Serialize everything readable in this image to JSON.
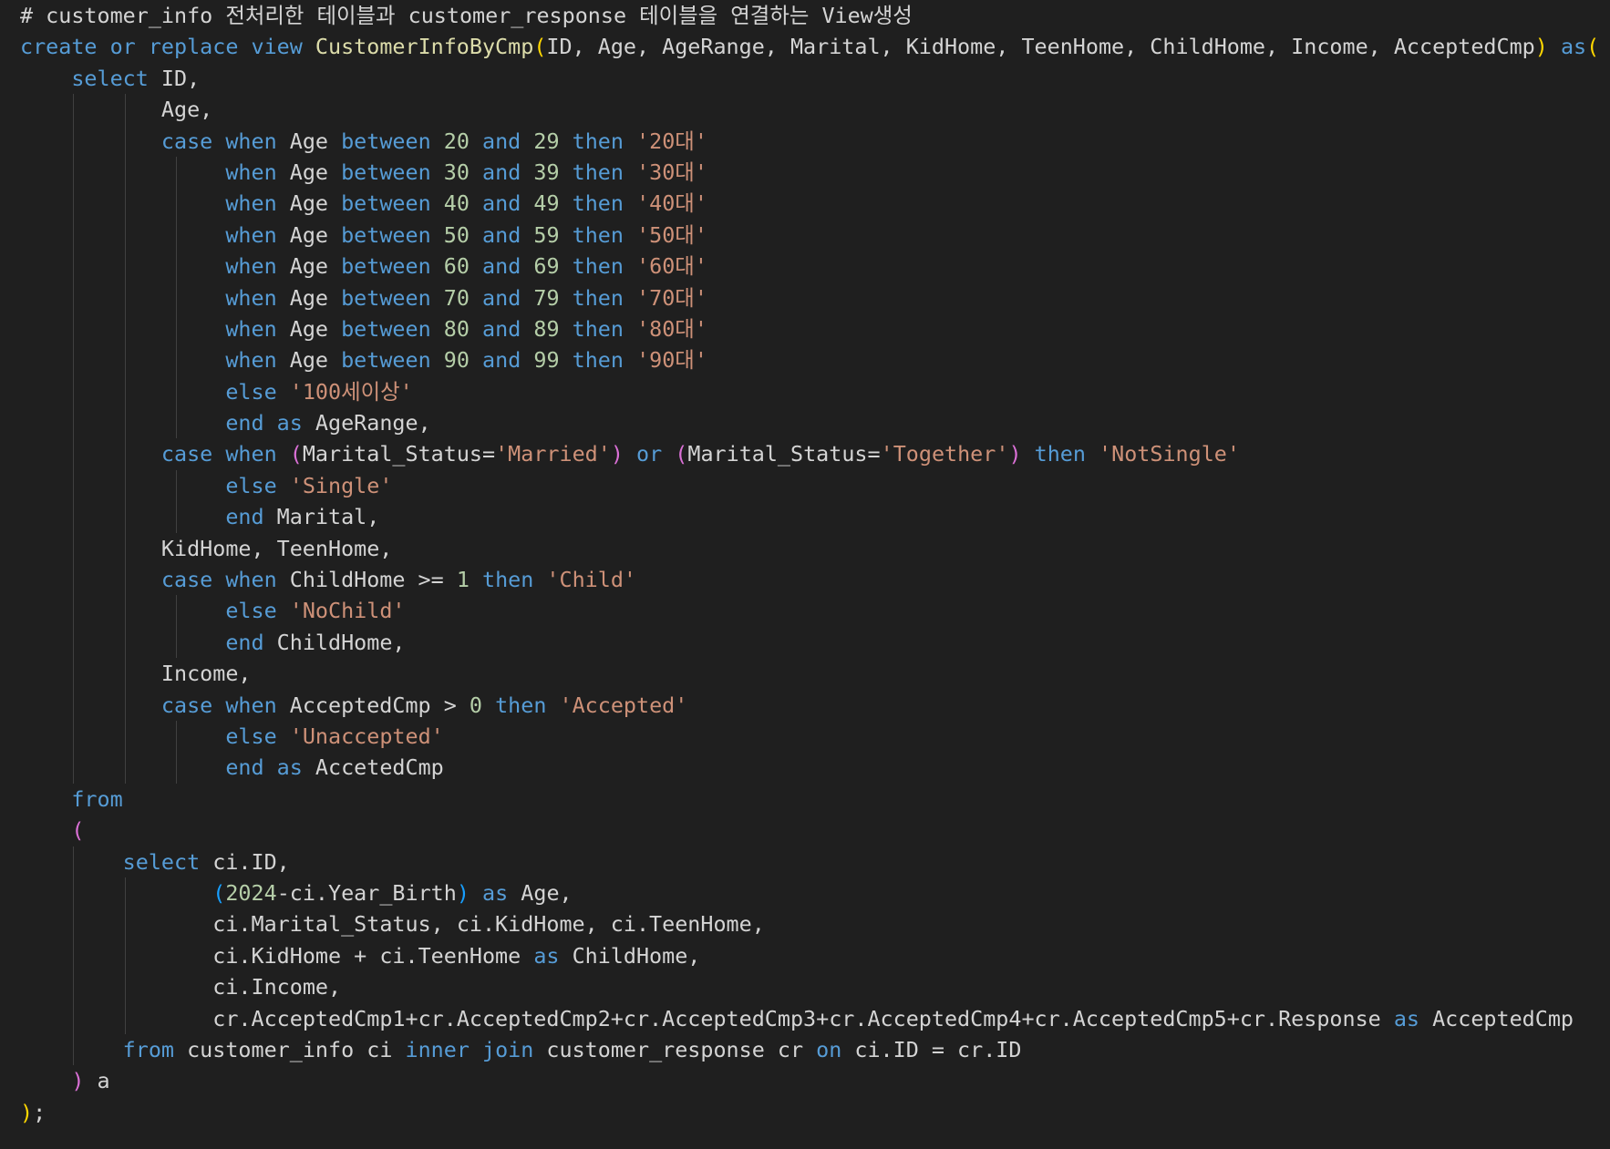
{
  "editor": {
    "lines": [
      {
        "indent": 0,
        "tokens": [
          {
            "t": "cmt",
            "v": "# customer_info 전처리한 테이블과 customer_response 테이블을 연결하는 View생성"
          }
        ]
      },
      {
        "indent": 0,
        "tokens": [
          {
            "t": "kw",
            "v": "create or replace view "
          },
          {
            "t": "fn",
            "v": "CustomerInfoByCmp"
          },
          {
            "t": "br1",
            "v": "("
          },
          {
            "t": "txt",
            "v": "ID, Age, AgeRange, Marital, KidHome, TeenHome, ChildHome, Income, AcceptedCmp"
          },
          {
            "t": "br1",
            "v": ")"
          },
          {
            "t": "txt",
            "v": " "
          },
          {
            "t": "kw",
            "v": "as"
          },
          {
            "t": "br1",
            "v": "("
          }
        ]
      },
      {
        "indent": 4,
        "tokens": [
          {
            "t": "kw",
            "v": "select "
          },
          {
            "t": "txt",
            "v": "ID,"
          }
        ]
      },
      {
        "indent": 11,
        "tokens": [
          {
            "t": "txt",
            "v": "Age,"
          }
        ]
      },
      {
        "indent": 11,
        "tokens": [
          {
            "t": "kw",
            "v": "case when "
          },
          {
            "t": "txt",
            "v": "Age "
          },
          {
            "t": "kw",
            "v": "between "
          },
          {
            "t": "num",
            "v": "20"
          },
          {
            "t": "txt",
            "v": " "
          },
          {
            "t": "kw",
            "v": "and "
          },
          {
            "t": "num",
            "v": "29"
          },
          {
            "t": "txt",
            "v": " "
          },
          {
            "t": "kw",
            "v": "then "
          },
          {
            "t": "str",
            "v": "'20대'"
          }
        ]
      },
      {
        "indent": 16,
        "tokens": [
          {
            "t": "kw",
            "v": "when "
          },
          {
            "t": "txt",
            "v": "Age "
          },
          {
            "t": "kw",
            "v": "between "
          },
          {
            "t": "num",
            "v": "30"
          },
          {
            "t": "txt",
            "v": " "
          },
          {
            "t": "kw",
            "v": "and "
          },
          {
            "t": "num",
            "v": "39"
          },
          {
            "t": "txt",
            "v": " "
          },
          {
            "t": "kw",
            "v": "then "
          },
          {
            "t": "str",
            "v": "'30대'"
          }
        ]
      },
      {
        "indent": 16,
        "tokens": [
          {
            "t": "kw",
            "v": "when "
          },
          {
            "t": "txt",
            "v": "Age "
          },
          {
            "t": "kw",
            "v": "between "
          },
          {
            "t": "num",
            "v": "40"
          },
          {
            "t": "txt",
            "v": " "
          },
          {
            "t": "kw",
            "v": "and "
          },
          {
            "t": "num",
            "v": "49"
          },
          {
            "t": "txt",
            "v": " "
          },
          {
            "t": "kw",
            "v": "then "
          },
          {
            "t": "str",
            "v": "'40대'"
          }
        ]
      },
      {
        "indent": 16,
        "tokens": [
          {
            "t": "kw",
            "v": "when "
          },
          {
            "t": "txt",
            "v": "Age "
          },
          {
            "t": "kw",
            "v": "between "
          },
          {
            "t": "num",
            "v": "50"
          },
          {
            "t": "txt",
            "v": " "
          },
          {
            "t": "kw",
            "v": "and "
          },
          {
            "t": "num",
            "v": "59"
          },
          {
            "t": "txt",
            "v": " "
          },
          {
            "t": "kw",
            "v": "then "
          },
          {
            "t": "str",
            "v": "'50대'"
          }
        ]
      },
      {
        "indent": 16,
        "tokens": [
          {
            "t": "kw",
            "v": "when "
          },
          {
            "t": "txt",
            "v": "Age "
          },
          {
            "t": "kw",
            "v": "between "
          },
          {
            "t": "num",
            "v": "60"
          },
          {
            "t": "txt",
            "v": " "
          },
          {
            "t": "kw",
            "v": "and "
          },
          {
            "t": "num",
            "v": "69"
          },
          {
            "t": "txt",
            "v": " "
          },
          {
            "t": "kw",
            "v": "then "
          },
          {
            "t": "str",
            "v": "'60대'"
          }
        ]
      },
      {
        "indent": 16,
        "tokens": [
          {
            "t": "kw",
            "v": "when "
          },
          {
            "t": "txt",
            "v": "Age "
          },
          {
            "t": "kw",
            "v": "between "
          },
          {
            "t": "num",
            "v": "70"
          },
          {
            "t": "txt",
            "v": " "
          },
          {
            "t": "kw",
            "v": "and "
          },
          {
            "t": "num",
            "v": "79"
          },
          {
            "t": "txt",
            "v": " "
          },
          {
            "t": "kw",
            "v": "then "
          },
          {
            "t": "str",
            "v": "'70대'"
          }
        ]
      },
      {
        "indent": 16,
        "tokens": [
          {
            "t": "kw",
            "v": "when "
          },
          {
            "t": "txt",
            "v": "Age "
          },
          {
            "t": "kw",
            "v": "between "
          },
          {
            "t": "num",
            "v": "80"
          },
          {
            "t": "txt",
            "v": " "
          },
          {
            "t": "kw",
            "v": "and "
          },
          {
            "t": "num",
            "v": "89"
          },
          {
            "t": "txt",
            "v": " "
          },
          {
            "t": "kw",
            "v": "then "
          },
          {
            "t": "str",
            "v": "'80대'"
          }
        ]
      },
      {
        "indent": 16,
        "tokens": [
          {
            "t": "kw",
            "v": "when "
          },
          {
            "t": "txt",
            "v": "Age "
          },
          {
            "t": "kw",
            "v": "between "
          },
          {
            "t": "num",
            "v": "90"
          },
          {
            "t": "txt",
            "v": " "
          },
          {
            "t": "kw",
            "v": "and "
          },
          {
            "t": "num",
            "v": "99"
          },
          {
            "t": "txt",
            "v": " "
          },
          {
            "t": "kw",
            "v": "then "
          },
          {
            "t": "str",
            "v": "'90대'"
          }
        ]
      },
      {
        "indent": 16,
        "tokens": [
          {
            "t": "kw",
            "v": "else "
          },
          {
            "t": "str",
            "v": "'100세이상'"
          }
        ]
      },
      {
        "indent": 16,
        "tokens": [
          {
            "t": "kw",
            "v": "end as "
          },
          {
            "t": "txt",
            "v": "AgeRange,"
          }
        ]
      },
      {
        "indent": 11,
        "tokens": [
          {
            "t": "kw",
            "v": "case when "
          },
          {
            "t": "br2",
            "v": "("
          },
          {
            "t": "txt",
            "v": "Marital_Status="
          },
          {
            "t": "str",
            "v": "'Married'"
          },
          {
            "t": "br2",
            "v": ")"
          },
          {
            "t": "txt",
            "v": " "
          },
          {
            "t": "kw",
            "v": "or "
          },
          {
            "t": "br2",
            "v": "("
          },
          {
            "t": "txt",
            "v": "Marital_Status="
          },
          {
            "t": "str",
            "v": "'Together'"
          },
          {
            "t": "br2",
            "v": ")"
          },
          {
            "t": "txt",
            "v": " "
          },
          {
            "t": "kw",
            "v": "then "
          },
          {
            "t": "str",
            "v": "'NotSingle'"
          }
        ]
      },
      {
        "indent": 16,
        "tokens": [
          {
            "t": "kw",
            "v": "else "
          },
          {
            "t": "str",
            "v": "'Single'"
          }
        ]
      },
      {
        "indent": 16,
        "tokens": [
          {
            "t": "kw",
            "v": "end "
          },
          {
            "t": "txt",
            "v": "Marital,"
          }
        ]
      },
      {
        "indent": 11,
        "tokens": [
          {
            "t": "txt",
            "v": "KidHome, TeenHome,"
          }
        ]
      },
      {
        "indent": 11,
        "tokens": [
          {
            "t": "kw",
            "v": "case when "
          },
          {
            "t": "txt",
            "v": "ChildHome >= "
          },
          {
            "t": "num",
            "v": "1"
          },
          {
            "t": "txt",
            "v": " "
          },
          {
            "t": "kw",
            "v": "then "
          },
          {
            "t": "str",
            "v": "'Child'"
          }
        ]
      },
      {
        "indent": 16,
        "tokens": [
          {
            "t": "kw",
            "v": "else "
          },
          {
            "t": "str",
            "v": "'NoChild'"
          }
        ]
      },
      {
        "indent": 16,
        "tokens": [
          {
            "t": "kw",
            "v": "end "
          },
          {
            "t": "txt",
            "v": "ChildHome,"
          }
        ]
      },
      {
        "indent": 11,
        "tokens": [
          {
            "t": "txt",
            "v": "Income,"
          }
        ]
      },
      {
        "indent": 11,
        "tokens": [
          {
            "t": "kw",
            "v": "case when "
          },
          {
            "t": "txt",
            "v": "AcceptedCmp > "
          },
          {
            "t": "num",
            "v": "0"
          },
          {
            "t": "txt",
            "v": " "
          },
          {
            "t": "kw",
            "v": "then "
          },
          {
            "t": "str",
            "v": "'Accepted'"
          }
        ]
      },
      {
        "indent": 16,
        "tokens": [
          {
            "t": "kw",
            "v": "else "
          },
          {
            "t": "str",
            "v": "'Unaccepted'"
          }
        ]
      },
      {
        "indent": 16,
        "tokens": [
          {
            "t": "kw",
            "v": "end as "
          },
          {
            "t": "txt",
            "v": "AccetedCmp"
          }
        ]
      },
      {
        "indent": 4,
        "tokens": [
          {
            "t": "kw",
            "v": "from"
          }
        ]
      },
      {
        "indent": 4,
        "tokens": [
          {
            "t": "br2",
            "v": "("
          }
        ]
      },
      {
        "indent": 8,
        "tokens": [
          {
            "t": "kw",
            "v": "select "
          },
          {
            "t": "txt",
            "v": "ci.ID,"
          }
        ]
      },
      {
        "indent": 15,
        "tokens": [
          {
            "t": "br3",
            "v": "("
          },
          {
            "t": "num",
            "v": "2024"
          },
          {
            "t": "txt",
            "v": "-ci.Year_Birth"
          },
          {
            "t": "br3",
            "v": ")"
          },
          {
            "t": "txt",
            "v": " "
          },
          {
            "t": "kw",
            "v": "as "
          },
          {
            "t": "txt",
            "v": "Age,"
          }
        ]
      },
      {
        "indent": 15,
        "tokens": [
          {
            "t": "txt",
            "v": "ci.Marital_Status, ci.KidHome, ci.TeenHome,"
          }
        ]
      },
      {
        "indent": 15,
        "tokens": [
          {
            "t": "txt",
            "v": "ci.KidHome + ci.TeenHome "
          },
          {
            "t": "kw",
            "v": "as "
          },
          {
            "t": "txt",
            "v": "ChildHome,"
          }
        ]
      },
      {
        "indent": 15,
        "tokens": [
          {
            "t": "txt",
            "v": "ci.Income,"
          }
        ]
      },
      {
        "indent": 15,
        "tokens": [
          {
            "t": "txt",
            "v": "cr.AcceptedCmp1+cr.AcceptedCmp2+cr.AcceptedCmp3+cr.AcceptedCmp4+cr.AcceptedCmp5+cr.Response "
          },
          {
            "t": "kw",
            "v": "as "
          },
          {
            "t": "txt",
            "v": "AcceptedCmp"
          }
        ]
      },
      {
        "indent": 8,
        "tokens": [
          {
            "t": "kw",
            "v": "from "
          },
          {
            "t": "txt",
            "v": "customer_info ci "
          },
          {
            "t": "kw",
            "v": "inner join "
          },
          {
            "t": "txt",
            "v": "customer_response cr "
          },
          {
            "t": "kw",
            "v": "on "
          },
          {
            "t": "txt",
            "v": "ci.ID = cr.ID"
          }
        ]
      },
      {
        "indent": 4,
        "tokens": [
          {
            "t": "br2",
            "v": ")"
          },
          {
            "t": "txt",
            "v": " a"
          }
        ]
      },
      {
        "indent": 0,
        "tokens": [
          {
            "t": "br1",
            "v": ")"
          },
          {
            "t": "txt",
            "v": ";"
          }
        ]
      }
    ]
  }
}
